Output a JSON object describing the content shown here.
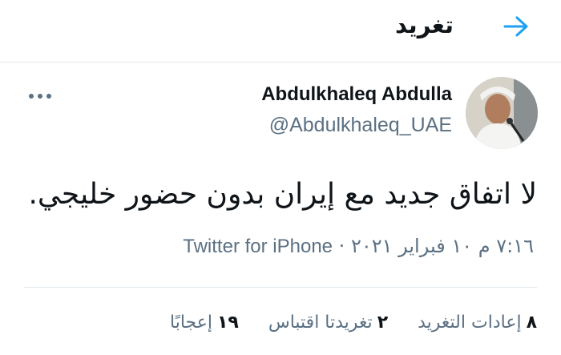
{
  "header": {
    "title": "تغريد"
  },
  "tweet": {
    "display_name": "Abdulkhaleq Abdulla",
    "handle": "@Abdulkhaleq_UAE",
    "text": "لا اتفاق جديد مع إيران بدون حضور خليجي.",
    "time": "٧:١٦ م",
    "date": "١٠ فبراير ٢٠٢١",
    "separator": "·",
    "source": "Twitter for iPhone"
  },
  "stats": {
    "retweets_count": "٨",
    "retweets_label": "إعادات التغريد",
    "quotes_count": "٢",
    "quotes_label": "تغريدتا اقتباس",
    "likes_count": "١٩",
    "likes_label": "إعجابًا"
  },
  "colors": {
    "accent": "#1da1f2",
    "muted": "#5b7083",
    "divider": "#e1e8ed"
  },
  "icons": {
    "back": "arrow-right-icon",
    "more": "more-horizontal-icon"
  }
}
